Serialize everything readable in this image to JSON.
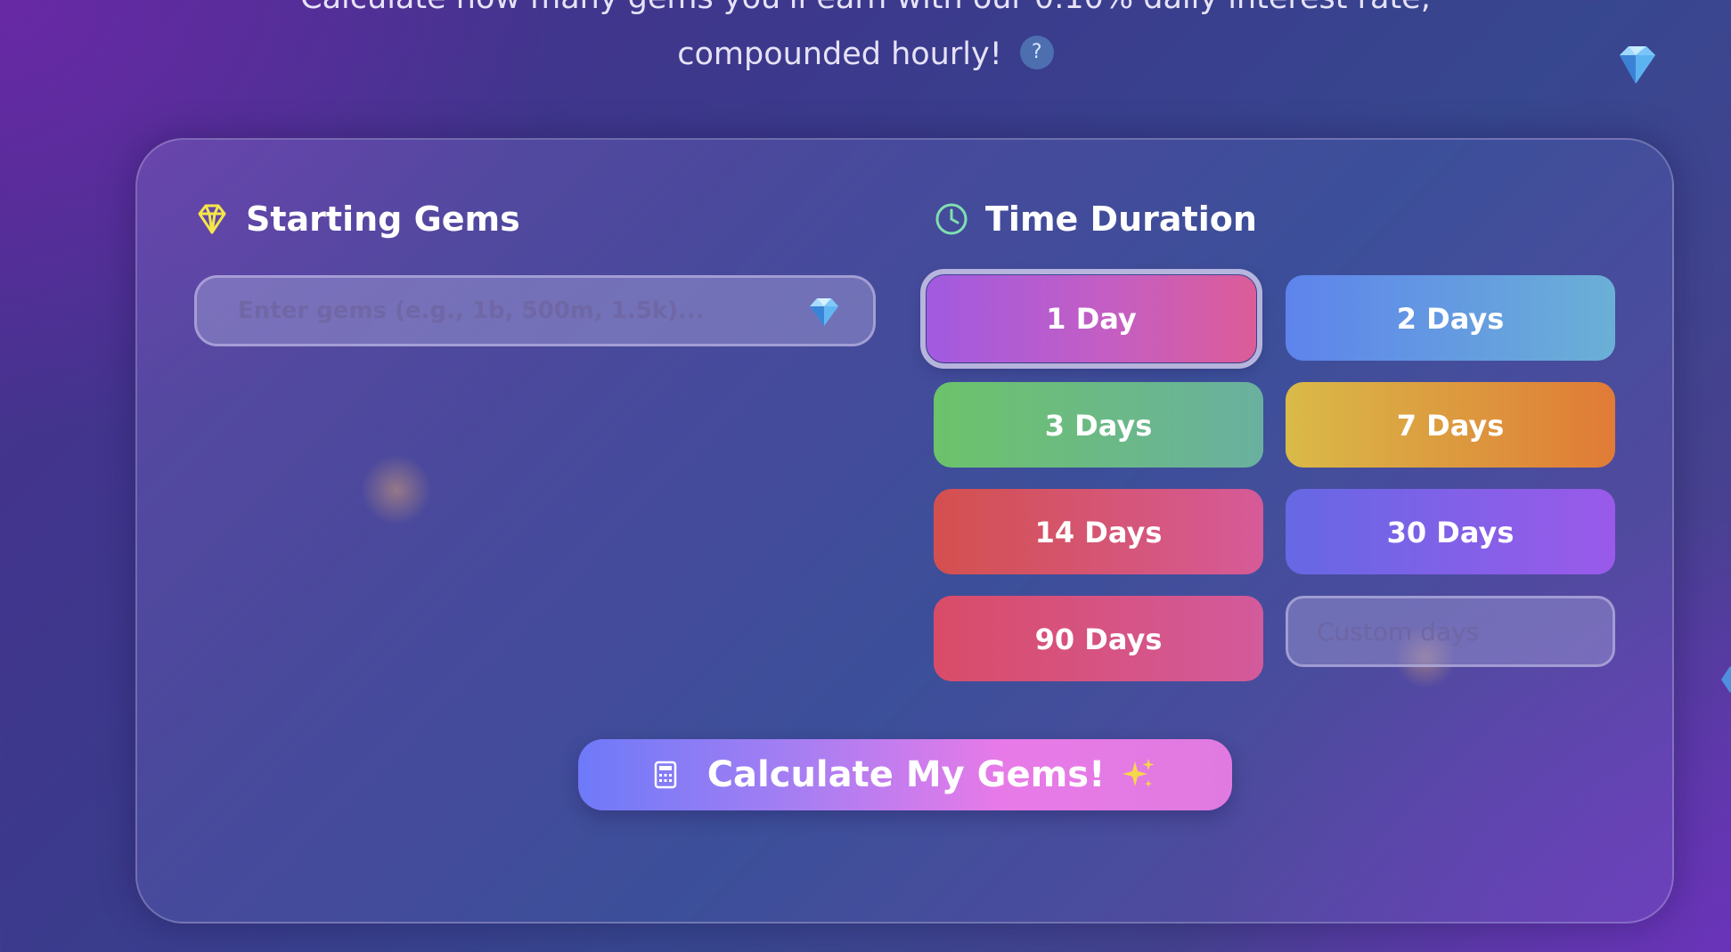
{
  "header": {
    "subtitle_line1": "Calculate how many gems you'll earn with our 0.10% daily interest rate,",
    "subtitle_line2": "compounded hourly!",
    "help_label": "?"
  },
  "starting_gems": {
    "title": "Starting Gems",
    "input_placeholder": "Enter gems (e.g., 1b, 500m, 1.5k)...",
    "input_value": ""
  },
  "time_duration": {
    "title": "Time Duration",
    "options": [
      {
        "label": "1 Day",
        "selected": true
      },
      {
        "label": "2 Days",
        "selected": false
      },
      {
        "label": "3 Days",
        "selected": false
      },
      {
        "label": "7 Days",
        "selected": false
      },
      {
        "label": "14 Days",
        "selected": false
      },
      {
        "label": "30 Days",
        "selected": false
      },
      {
        "label": "90 Days",
        "selected": false
      }
    ],
    "custom_placeholder": "Custom days"
  },
  "action": {
    "calculate_label": "Calculate My Gems!"
  },
  "icons": {
    "starting_gems": "gem-outline-icon",
    "time_duration": "clock-icon",
    "input": "diamond-icon",
    "calculate": "calculator-icon",
    "sparkle": "sparkles-icon",
    "floating": "diamond-icon"
  },
  "colors": {
    "accent_gem": "#f5e64a",
    "accent_clock": "#7fe0b0",
    "calculate_start": "#6e7af8",
    "calculate_end": "#e87ae8"
  }
}
